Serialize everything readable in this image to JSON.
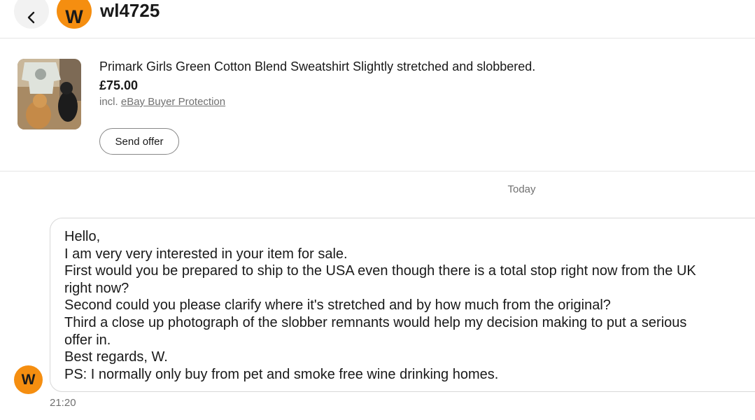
{
  "header": {
    "avatar_initial": "W",
    "username": "wl4725"
  },
  "listing": {
    "title": "Primark Girls Green Cotton Blend Sweatshirt Slightly stretched and slobbered.",
    "price": "£75.00",
    "protection_prefix": "incl.",
    "protection_link": "eBay Buyer Protection",
    "send_offer_label": "Send offer"
  },
  "conversation": {
    "date_label": "Today",
    "message": {
      "sender_initial": "W",
      "lines": [
        "Hello,",
        "I am very very interested in your item for sale.",
        "First would you be prepared to ship to the USA even though there is a total stop right now from the UK",
        "right now?",
        "Second could you please clarify where it's stretched and by how much from the original?",
        "Third a close up photograph of the slobber remnants would help my decision making to put a serious",
        "offer in.",
        "Best regards, W.",
        "PS: I normally only buy from pet and smoke free wine drinking homes."
      ],
      "time": "21:20"
    }
  },
  "colors": {
    "avatar": "#f58e10",
    "text": "#191919",
    "muted": "#707070",
    "border": "#d8d8d8"
  }
}
